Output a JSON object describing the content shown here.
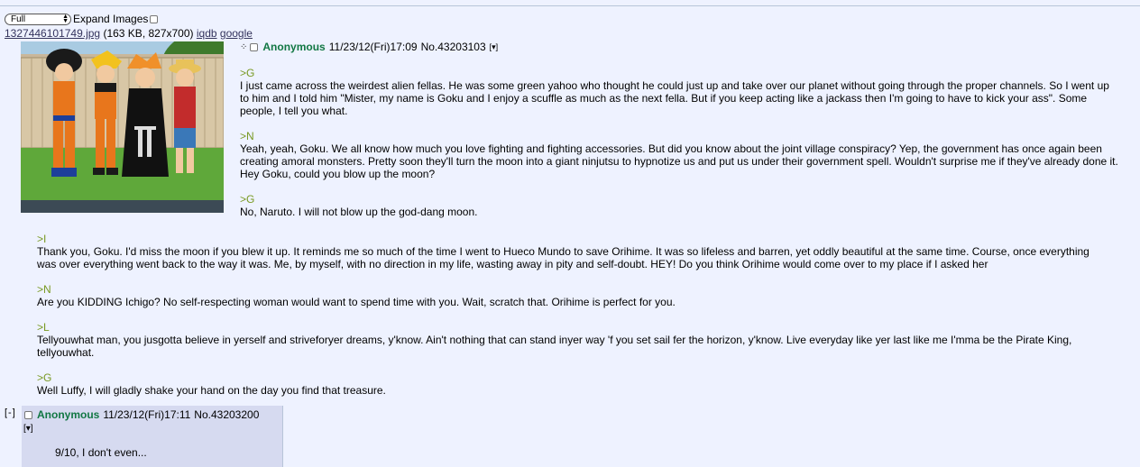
{
  "controls": {
    "view_select": "Full",
    "expand_images_label": "Expand Images"
  },
  "op": {
    "file_name": "1327446101749.jpg",
    "file_meta": "(163 KB, 827x700)",
    "iqdb": "iqdb",
    "google": "google",
    "name": "Anonymous",
    "datetime": "11/23/12(Fri)17:09",
    "post_no": "No.43203103",
    "menu": "[▾]",
    "blocks": [
      {
        "quote": ">G",
        "text": "I just came across the weirdest alien fellas. He was some green yahoo who thought he could just up and take over our planet without going through the proper channels. So I went up to him and I told him \"Mister, my name is Goku and I enjoy a scuffle as much as the next fella. But if you keep acting like a jackass then I'm going to have to kick your ass\". Some people, I tell you what."
      },
      {
        "quote": ">N",
        "text": "Yeah, yeah, Goku. We all know how much you love fighting and fighting accessories. But did you know about the joint village conspiracy? Yep, the government has once again been creating amoral monsters. Pretty soon they'll turn the moon into a giant ninjutsu to hypnotize us and put us under their government spell. Wouldn't surprise me if they've already done it. Hey Goku, could you blow up the moon?"
      },
      {
        "quote": ">G",
        "text": "No, Naruto. I will not blow up the god-dang moon."
      }
    ],
    "blocks_cont": [
      {
        "quote": ">I",
        "text": "Thank you, Goku. I'd miss the moon if you blew it up. It reminds me so much of the time I went to Hueco Mundo to save Orihime. It was so lifeless and barren, yet oddly beautiful at the same time. Course, once everything was over everything went back to the way it was. Me, by myself, with no direction in my life, wasting away in pity and self-doubt. HEY! Do you think Orihime would come over to my place if I asked her"
      },
      {
        "quote": ">N",
        "text": "Are you KIDDING Ichigo? No self-respecting woman would want to spend time with you. Wait, scratch that. Orihime is perfect for you."
      },
      {
        "quote": ">L",
        "text": "Tellyouwhat man, you jusgotta believe in yerself and striveforyer dreams, y'know. Ain't nothing that can stand inyer way 'f you set sail fer the horizon, y'know. Live everyday like yer last like me I'mma be the Pirate King, tellyouwhat."
      },
      {
        "quote": ">G",
        "text": "Well Luffy, I will gladly shake your hand on the day you find that treasure."
      }
    ]
  },
  "reply": {
    "side": "[-]",
    "name": "Anonymous",
    "datetime": "11/23/12(Fri)17:11",
    "post_no": "No.43203200",
    "menu": "[▾]",
    "text": "9/10, I don't even..."
  }
}
